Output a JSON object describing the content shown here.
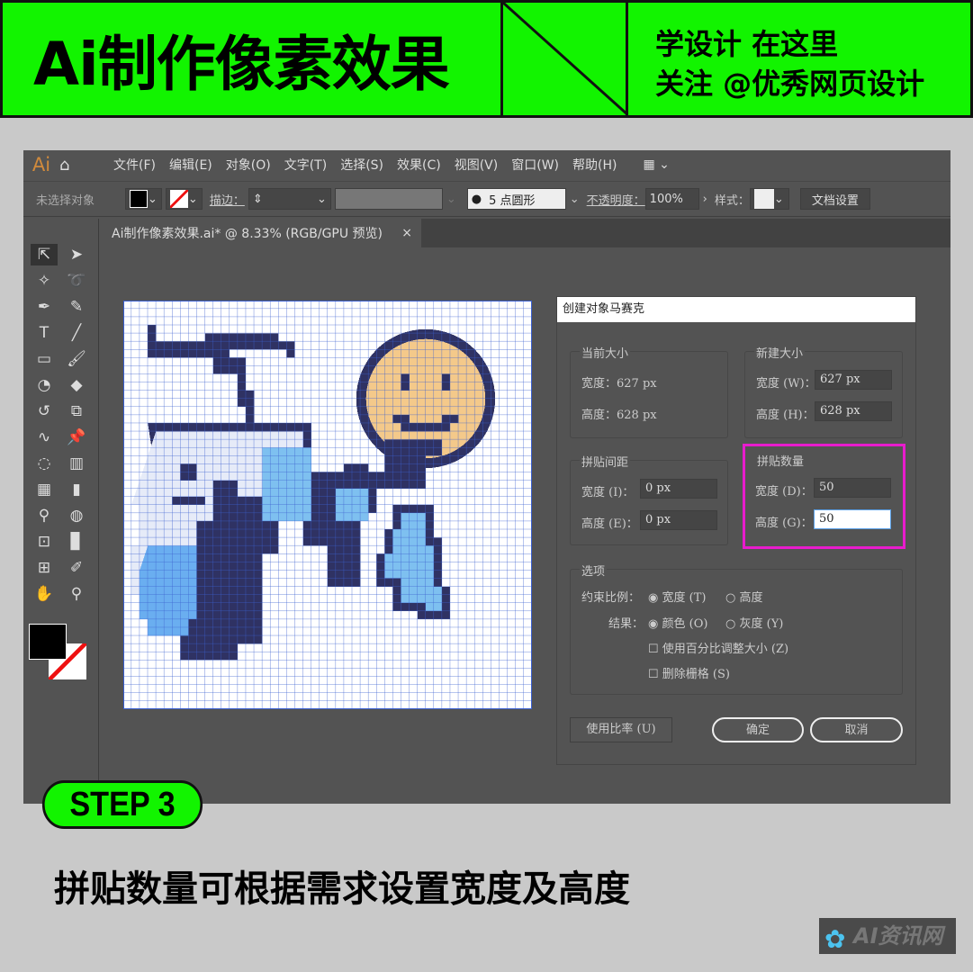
{
  "header": {
    "title": "Ai制作像素效果",
    "line1": "学设计  在这里",
    "line2": "关注 @优秀网页设计"
  },
  "app": {
    "logo": "Ai",
    "menus": [
      "文件(F)",
      "编辑(E)",
      "对象(O)",
      "文字(T)",
      "选择(S)",
      "效果(C)",
      "视图(V)",
      "窗口(W)",
      "帮助(H)"
    ]
  },
  "control": {
    "selection": "未选择对象",
    "stroke_label": "描边：",
    "brush": "5 点圆形",
    "opacity_label": "不透明度：",
    "opacity": "100%",
    "style_label": "样式：",
    "doc_settings": "文档设置"
  },
  "tab": {
    "label": "Ai制作像素效果.ai* @ 8.33% (RGB/GPU 预览)",
    "close": "×"
  },
  "dialog": {
    "title": "创建对象马赛克",
    "current": {
      "label": "当前大小",
      "width": "宽度：627 px",
      "height": "高度：628 px"
    },
    "new": {
      "label": "新建大小",
      "width_label": "宽度 (W)：",
      "width": "627 px",
      "height_label": "高度 (H)：",
      "height": "628 px"
    },
    "spacing": {
      "label": "拼贴间距",
      "width_label": "宽度 (I)：",
      "width": "0 px",
      "height_label": "高度 (E)：",
      "height": "0 px"
    },
    "count": {
      "label": "拼贴数量",
      "width_label": "宽度 (D)：",
      "width": "50",
      "height_label": "高度 (G)：",
      "height": "50",
      "highlight": "#e81ccd"
    },
    "options": {
      "label": "选项",
      "constrain_label": "约束比例：",
      "constrain_width": "宽度 (T)",
      "constrain_height": "高度",
      "result_label": "结果：",
      "result_color": "颜色 (O)",
      "result_gray": "灰度 (Y)",
      "percent": "使用百分比调整大小 (Z)",
      "delete_raster": "删除栅格 (S)"
    },
    "use_ratio": "使用比率 (U)",
    "ok": "确定",
    "cancel": "取消"
  },
  "step": "STEP 3",
  "caption": "拼贴数量可根据需求设置宽度及高度",
  "watermark": "AI资讯网",
  "colors": {
    "accent": "#12f400"
  }
}
